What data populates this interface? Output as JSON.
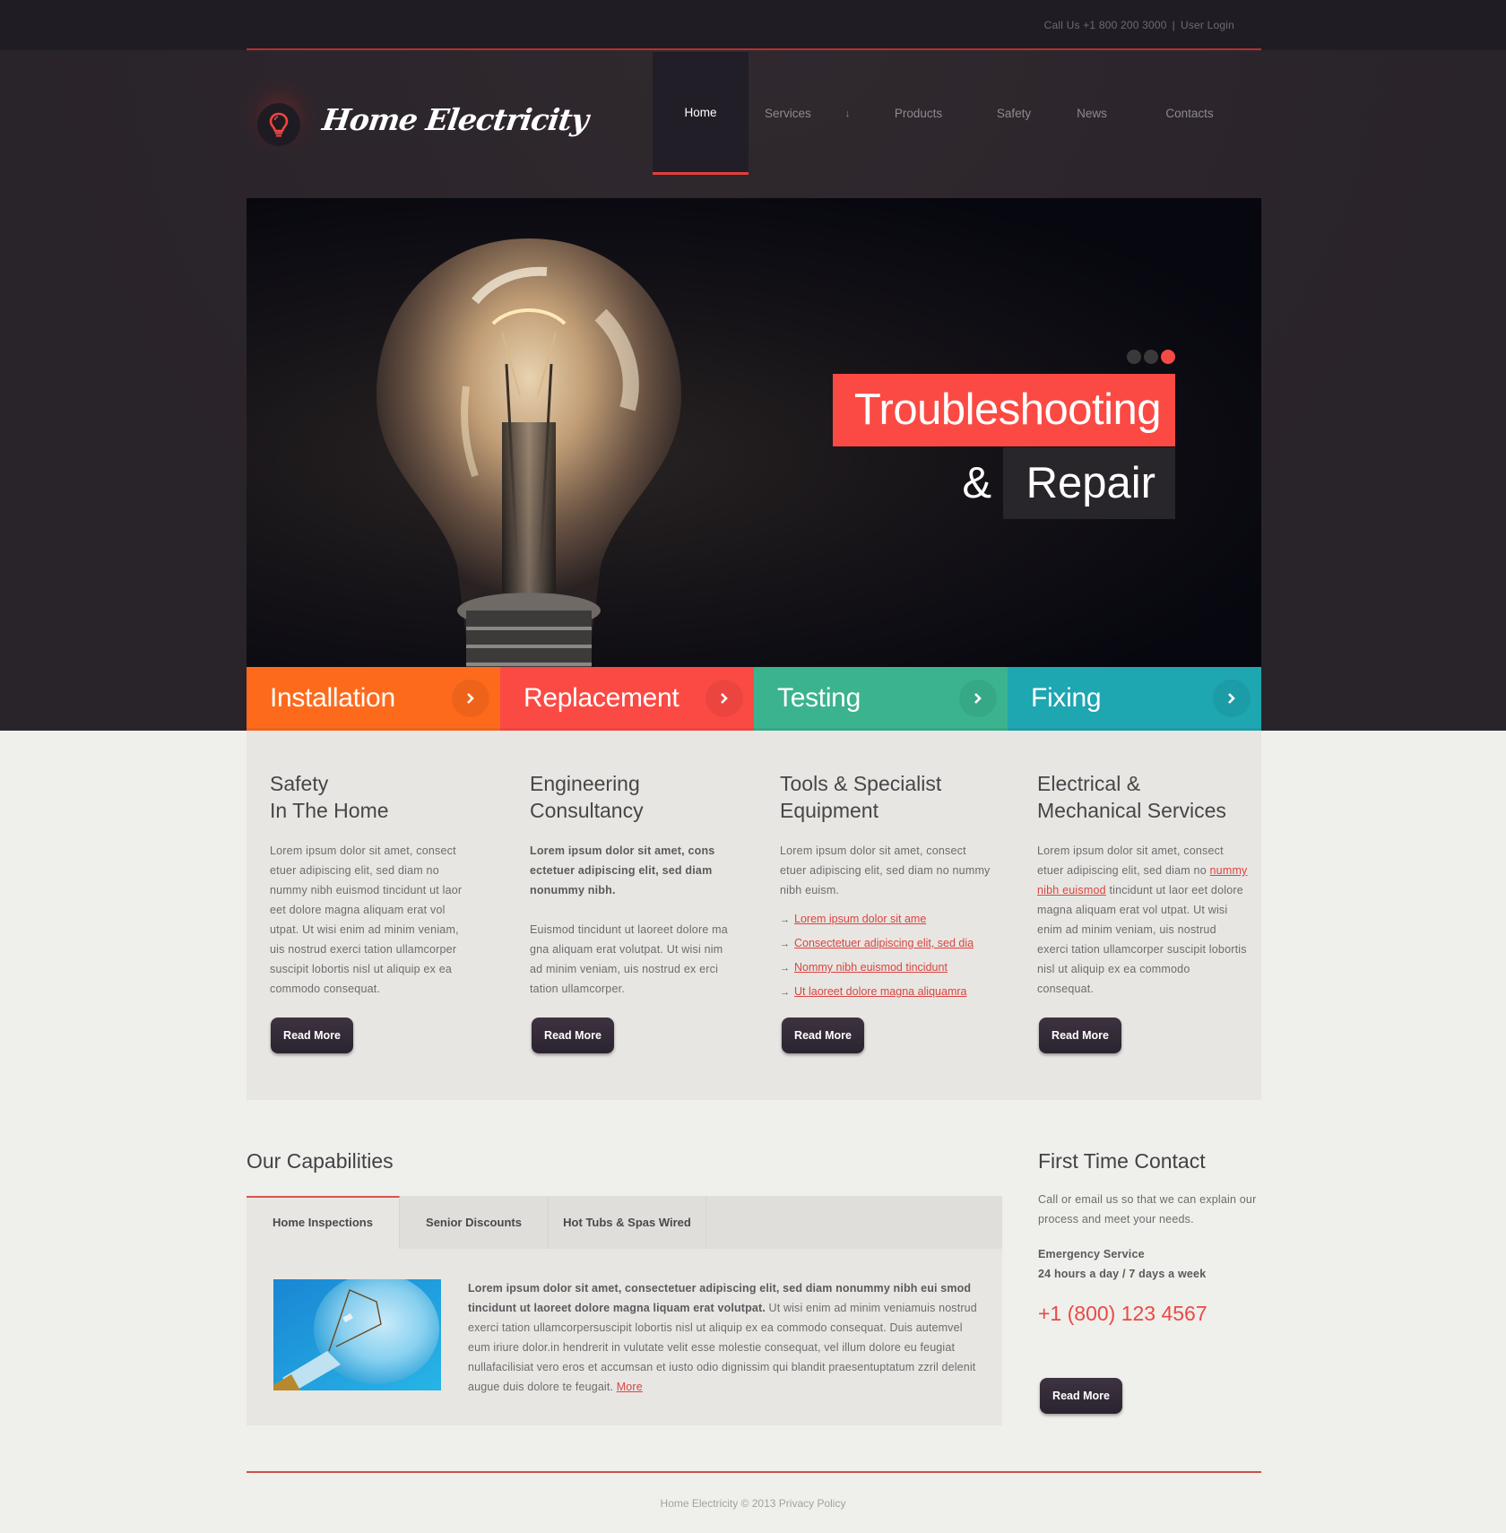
{
  "topbar": {
    "call_label": "Call Us +1 800 200 3000",
    "separator": "|",
    "login_label": "User Login"
  },
  "header": {
    "logo_text": "Home Electricity",
    "logo_icon": "lightbulb-icon",
    "nav": [
      {
        "label": "Home",
        "active": true
      },
      {
        "label": "Services",
        "has_dropdown": true,
        "dropdown_icon": "↓"
      },
      {
        "label": "Products"
      },
      {
        "label": "Safety"
      },
      {
        "label": "News"
      },
      {
        "label": "Contacts"
      }
    ]
  },
  "slider": {
    "caption_line1": "Troubleshooting",
    "caption_amp": "&",
    "caption_line2": "Repair",
    "dots_count": 3,
    "active_dot": 3
  },
  "service_tabs": [
    {
      "label": "Installation",
      "color": "#fd6a1c",
      "icon": "chevron-right-icon"
    },
    {
      "label": "Replacement",
      "color": "#fb4a44",
      "icon": "chevron-right-icon"
    },
    {
      "label": "Testing",
      "color": "#3bb38e",
      "icon": "chevron-right-icon"
    },
    {
      "label": "Fixing",
      "color": "#1ea6b1",
      "icon": "chevron-right-icon"
    }
  ],
  "features": [
    {
      "title_line1": "Safety",
      "title_line2": "In The Home",
      "text": "Lorem ipsum dolor sit amet, consect etuer adipiscing elit, sed diam no nummy nibh euismod tincidunt ut laor eet dolore magna aliquam erat vol utpat. Ut wisi enim ad minim veniam, uis nostrud exerci tation ullamcorper suscipit lobortis nisl ut aliquip ex ea commodo consequat.",
      "button": "Read More"
    },
    {
      "title_line1": "Engineering",
      "title_line2": "Consultancy",
      "bold_text": "Lorem ipsum dolor sit amet, cons ectetuer adipiscing elit, sed diam nonummy nibh.",
      "text": "Euismod tincidunt ut laoreet dolore ma gna aliquam erat volutpat. Ut wisi nim ad minim veniam, uis nostrud ex erci tation ullamcorper.",
      "button": "Read More"
    },
    {
      "title_line1": "Tools & Specialist",
      "title_line2": "Equipment",
      "text": "Lorem ipsum dolor sit amet, consect etuer adipiscing elit, sed diam no nummy nibh euism.",
      "links": [
        "Lorem ipsum dolor sit ame",
        "Consectetuer adipiscing elit, sed dia",
        "Nommy nibh euismod tincidunt",
        "Ut laoreet dolore magna aliquamra"
      ],
      "button": "Read More"
    },
    {
      "title_line1": "Electrical &",
      "title_line2": "Mechanical Services",
      "text_before": "Lorem ipsum dolor sit amet, consect etuer adipiscing elit, sed diam no ",
      "link": "nummy nibh euismod",
      "text_after": " tincidunt ut laor eet dolore magna aliquam erat vol utpat. Ut wisi enim ad minim veniam, uis nostrud exerci tation ullamcorper suscipit lobortis nisl ut aliquip ex ea commodo consequat.",
      "button": "Read More"
    }
  ],
  "capabilities": {
    "title": "Our Capabilities",
    "tabs": [
      {
        "label": "Home Inspections",
        "active": true
      },
      {
        "label": "Senior Discounts"
      },
      {
        "label": "Hot Tubs & Spas Wired"
      }
    ],
    "panel": {
      "bold_text": "Lorem ipsum dolor sit amet, consectetuer adipiscing elit, sed diam nonummy nibh eui smod tincidunt ut laoreet dolore magna liquam erat volutpat.",
      "text": " Ut wisi enim ad minim veniamuis nostrud exerci tation ullamcorpersuscipit lobortis nisl ut aliquip ex ea commodo consequat. Duis autemvel eum iriure dolor.in hendrerit in vulutate velit esse molestie consequat, vel illum dolore eu feugiat nullafacilisiat vero eros et accumsan et iusto odio dignissim qui blandit praesentuptatum zzril delenit augue duis dolore te feugait. ",
      "more_link": "More"
    }
  },
  "contact": {
    "title": "First Time Contact",
    "text": "Call or email us so that we can explain our process and meet your needs.",
    "emergency_line1": "Emergency Service",
    "emergency_line2": "24 hours a day / 7 days a week",
    "phone": "+1 (800) 123 4567",
    "button": "Read More"
  },
  "footer": {
    "brand": "Home Electricity",
    "copyright": "© 2013",
    "privacy": "Privacy Policy"
  },
  "colors": {
    "accent_red": "#fb4a44",
    "dark_bg": "#2c2529",
    "light_bg": "#efefeb"
  }
}
